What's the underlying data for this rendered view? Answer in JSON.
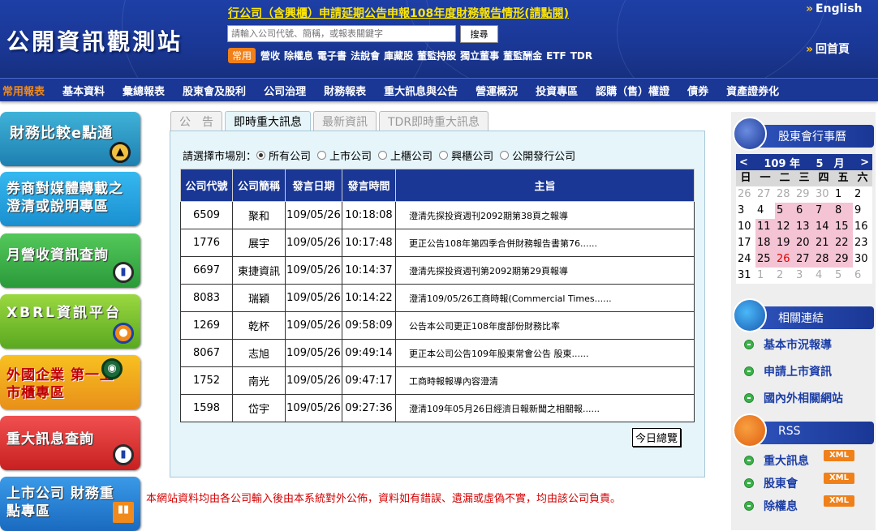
{
  "header": {
    "logo": "公開資訊觀測站",
    "announcement": "行公司（含興櫃）申請延期公告申報108年度財務報告情形(請點閱)",
    "search_placeholder": "請輸入公司代號、簡稱，或報表關鍵字",
    "search_button": "搜尋",
    "quick_badge": "常用",
    "quick_links": [
      "營收",
      "除權息",
      "電子書",
      "法說會",
      "庫藏股",
      "董監持股",
      "獨立董事",
      "董監酬金",
      "ETF",
      "TDR"
    ],
    "lang": "English",
    "home": "回首頁"
  },
  "menu": [
    "常用報表",
    "基本資料",
    "彙總報表",
    "股東會及股利",
    "公司治理",
    "財務報表",
    "重大訊息與公告",
    "營運概況",
    "投資專區",
    "認購（售）權證",
    "債券",
    "資產證券化"
  ],
  "left_buttons": [
    {
      "text": "財務比較e點通"
    },
    {
      "text": "券商對媒體轉載之 澄清或說明專區"
    },
    {
      "text": "月營收資訊查詢"
    },
    {
      "text": "XBRL資訊平台"
    },
    {
      "text": "外國企業 第一上市櫃專區"
    },
    {
      "text": "重大訊息查詢"
    },
    {
      "text": "上市公司 財務重點專區"
    }
  ],
  "tabs": [
    "公　告",
    "即時重大訊息",
    "最新資訊",
    "TDR即時重大訊息"
  ],
  "market_filter": {
    "label": "請選擇市場別：",
    "options": [
      "所有公司",
      "上市公司",
      "上櫃公司",
      "興櫃公司",
      "公開發行公司"
    ],
    "selected": 0
  },
  "table": {
    "headers": [
      "公司代號",
      "公司簡稱",
      "發言日期",
      "發言時間",
      "主旨"
    ],
    "rows": [
      [
        "6509",
        "聚和",
        "109/05/26",
        "10:18:08",
        "澄清先探投資週刊2092期第38頁之報導"
      ],
      [
        "1776",
        "展宇",
        "109/05/26",
        "10:17:48",
        "更正公告108年第四季合併財務報告書第76......"
      ],
      [
        "6697",
        "東捷資訊",
        "109/05/26",
        "10:14:37",
        "澄清先探投資週刊第2092期第29頁報導"
      ],
      [
        "8083",
        "瑞穎",
        "109/05/26",
        "10:14:22",
        "澄清109/05/26工商時報(Commercial Times......"
      ],
      [
        "1269",
        "乾杯",
        "109/05/26",
        "09:58:09",
        "公告本公司更正108年度部份財務比率"
      ],
      [
        "8067",
        "志旭",
        "109/05/26",
        "09:49:14",
        "更正本公司公告109年股東常會公告 股東......"
      ],
      [
        "1752",
        "南光",
        "109/05/26",
        "09:47:17",
        "工商時報報導內容澄清"
      ],
      [
        "1598",
        "岱宇",
        "109/05/26",
        "09:27:36",
        "澄清109年05月26日經濟日報新聞之相關報......"
      ]
    ],
    "today_button": "今日總覽"
  },
  "disclaimer": "本網站資料均由各公司輸入後由本系統對外公佈，資料如有錯誤、遺漏或虛偽不實，均由該公司負責。",
  "calendar": {
    "title": "股東會行事曆",
    "year": "109 年",
    "month": "5　月",
    "prev": "<",
    "next": ">",
    "weekdays": [
      "日",
      "一",
      "二",
      "三",
      "四",
      "五",
      "六"
    ],
    "days": [
      [
        "26",
        "dim"
      ],
      [
        "27",
        "dim"
      ],
      [
        "28",
        "dim"
      ],
      [
        "29",
        "dim"
      ],
      [
        "30",
        "dim"
      ],
      [
        "1",
        ""
      ],
      [
        "2",
        ""
      ],
      [
        "3",
        ""
      ],
      [
        "4",
        ""
      ],
      [
        "5",
        "hl"
      ],
      [
        "6",
        "hl"
      ],
      [
        "7",
        "hl"
      ],
      [
        "8",
        "hl"
      ],
      [
        "9",
        ""
      ],
      [
        "10",
        ""
      ],
      [
        "11",
        "hl"
      ],
      [
        "12",
        "hl"
      ],
      [
        "13",
        "hl"
      ],
      [
        "14",
        "hl"
      ],
      [
        "15",
        "hl"
      ],
      [
        "16",
        ""
      ],
      [
        "17",
        ""
      ],
      [
        "18",
        "hl"
      ],
      [
        "19",
        "hl"
      ],
      [
        "20",
        "hl"
      ],
      [
        "21",
        "hl"
      ],
      [
        "22",
        "hl"
      ],
      [
        "23",
        ""
      ],
      [
        "24",
        ""
      ],
      [
        "25",
        "hl"
      ],
      [
        "26",
        "red"
      ],
      [
        "27",
        "hl"
      ],
      [
        "28",
        "hl"
      ],
      [
        "29",
        "hl"
      ],
      [
        "30",
        ""
      ],
      [
        "31",
        ""
      ],
      [
        "1",
        "dim"
      ],
      [
        "2",
        "dim"
      ],
      [
        "3",
        "dim"
      ],
      [
        "4",
        "dim"
      ],
      [
        "5",
        "dim"
      ],
      [
        "6",
        "dim"
      ]
    ]
  },
  "related": {
    "title": "相關連結",
    "links": [
      "基本市況報導",
      "申請上市資訊",
      "國內外相關網站"
    ]
  },
  "rss": {
    "title": "RSS",
    "links": [
      "重大訊息",
      "股東會",
      "除權息"
    ],
    "xml_label": "XML"
  }
}
